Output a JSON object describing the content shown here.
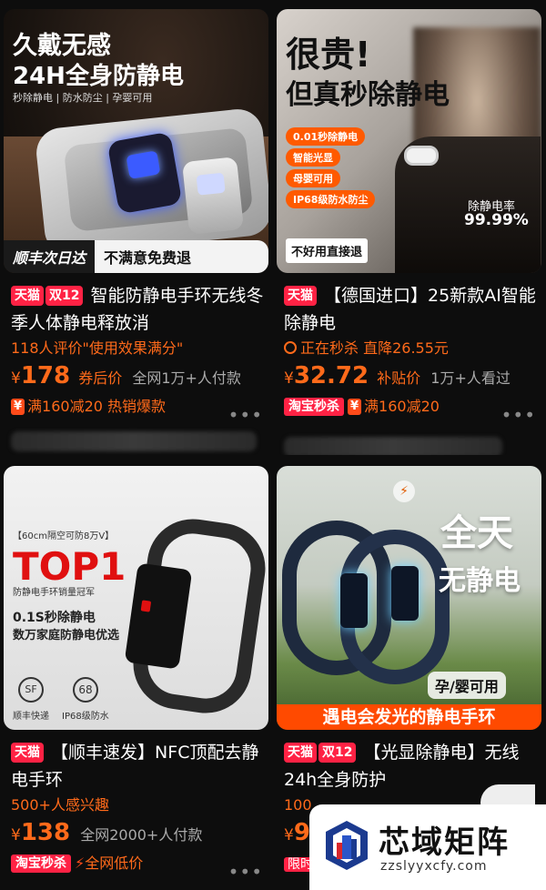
{
  "products": [
    {
      "image": {
        "headline1": "久戴无感",
        "headline2": "24H全身防静电",
        "features": "秒除静电 | 防水防尘 | 孕婴可用",
        "shipping_badge": "顺丰次日达",
        "guarantee_badge": "不满意免费退"
      },
      "tags": [
        "天猫",
        "双12"
      ],
      "title": "智能防静电手环无线冬季人体静电释放消",
      "meta": "118人评价\"使用效果满分\"",
      "currency": "¥",
      "price": "178",
      "price_note": "券后价",
      "sold": "全网1万+人付款",
      "promo_badge": "¥",
      "promo": "满160减20  热销爆款"
    },
    {
      "image": {
        "headline1": "很贵!",
        "headline2": "但真秒除静电",
        "features": [
          "0.01秒除静电",
          "智能光显",
          "母婴可用",
          "IP68级防水防尘"
        ],
        "stat_label": "除静电率",
        "stat_value": "99.99%",
        "return_badge": "不好用直接退"
      },
      "tags": [
        "天猫"
      ],
      "title": "【德国进口】25新款AI智能除静电",
      "meta_icon": "alarm-clock",
      "meta": "正在秒杀  直降26.55元",
      "currency": "¥",
      "price": "32.72",
      "price_note": "补贴价",
      "sold": "1万+人看过",
      "promo_tb": "淘宝秒杀",
      "promo_badge": "¥",
      "promo": "满160减20"
    },
    {
      "image": {
        "spec": "【60cm隔空可防8万V】",
        "rank": "TOP1",
        "rank_sub": "防静电手环销量冠军",
        "line1": "0.1S秒除静电",
        "line2": "数万家庭防静电优选",
        "icon1_label": "顺丰快递",
        "icon2_text": "68",
        "icon2_label": "IP68级防水"
      },
      "tags": [
        "天猫"
      ],
      "title": "【顺丰速发】NFC顶配去静电手环",
      "meta": "500+人感兴趣",
      "currency": "¥",
      "price": "138",
      "price_note": "",
      "sold": "全网2000+人付款",
      "promo_tb": "淘宝秒杀",
      "promo": "全网低价"
    },
    {
      "image": {
        "headline1": "全天",
        "headline2": "无静电",
        "badge": "孕/婴可用",
        "banner": "遇电会发光的静电手环"
      },
      "tags": [
        "天猫",
        "双12"
      ],
      "title": "【光显除静电】无线24h全身防护",
      "meta": "100",
      "currency": "¥",
      "price": "9",
      "promo": "限时"
    }
  ],
  "watermark": {
    "name": "芯域矩阵",
    "url": "zzslyyxcfy.com"
  },
  "colors": {
    "accent": "#ff6a1a",
    "tmall": "#ff2244",
    "background": "#0d0d0d"
  }
}
